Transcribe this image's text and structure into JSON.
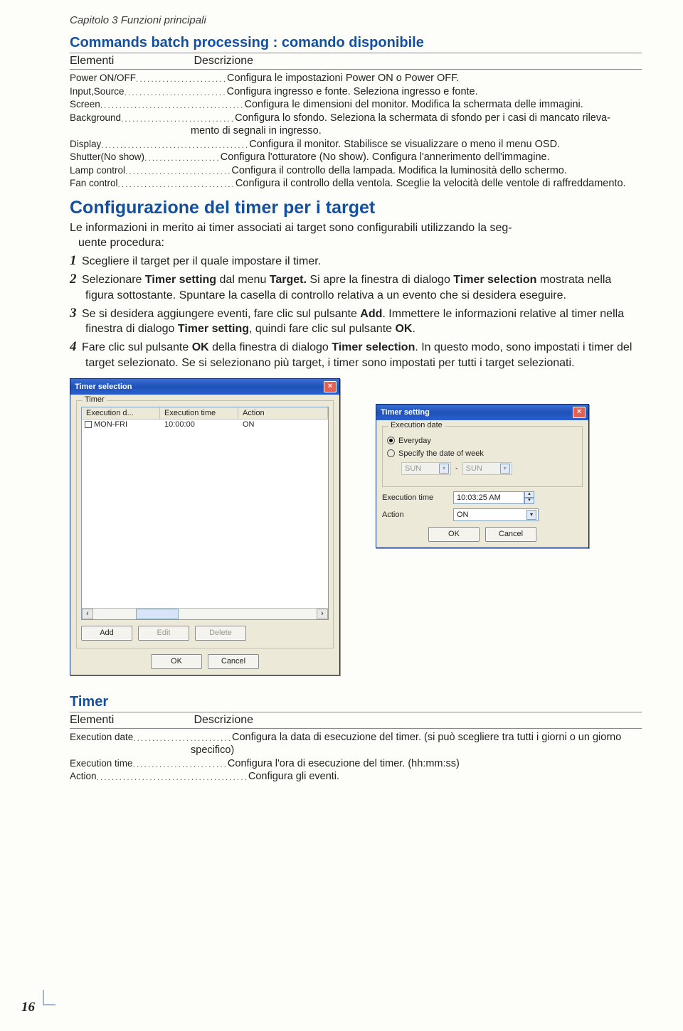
{
  "header": {
    "chapter": "Capitolo 3 Funzioni principali"
  },
  "section1": {
    "title": "Commands batch processing : comando disponibile",
    "col1": "Elementi",
    "col2": "Descrizione",
    "rows": [
      {
        "term": "Power ON/OFF",
        "dots": "........................",
        "desc": "Configura le impostazioni Power ON o Power OFF."
      },
      {
        "term": "Input,Source",
        "dots": "...........................",
        "desc": "Configura ingresso e fonte. Seleziona ingresso e fonte."
      },
      {
        "term": "Screen",
        "dots": "......................................",
        "desc": "Configura le dimensioni del monitor. Modifica la schermata delle immagini."
      },
      {
        "term": "Background",
        "dots": "..............................",
        "desc": "Configura lo sfondo. Seleziona la schermata di sfondo per i casi di mancato rileva-"
      },
      {
        "cont": "mento di segnali in ingresso."
      },
      {
        "term": "Display",
        "dots": ".......................................",
        "desc": "Configura il monitor. Stabilisce se visualizzare o meno il menu OSD."
      },
      {
        "term": "Shutter(No show)",
        "dots": "....................",
        "desc": "Configura l'otturatore (No show). Configura l'annerimento dell'immagine."
      },
      {
        "term": "Lamp control",
        "dots": "............................",
        "desc": "Configura il controllo della lampada. Modifica la luminosità dello schermo."
      },
      {
        "term": "Fan control",
        "dots": "...............................",
        "desc": "Configura il controllo della ventola. Sceglie la velocità delle ventole di raffreddamento."
      }
    ]
  },
  "section2": {
    "title": "Configurazione del timer per i target",
    "intro1": "Le informazioni in merito ai timer associati ai target sono configurabili utilizzando la seg-",
    "intro2": "uente procedura:",
    "steps": {
      "s1": {
        "n": "1",
        "t": "Scegliere il target per il quale impostare il timer."
      },
      "s2": {
        "n": "2",
        "a": "Selezionare ",
        "b1": "Timer setting",
        "c": " dal menu ",
        "b2": "Target.",
        "d": " Si apre la finestra di dialogo ",
        "b3": "Timer selection",
        "e": " mostrata nella figura sottostante. Spuntare la casella di controllo relativa a un evento che si desidera eseguire."
      },
      "s3": {
        "n": "3",
        "a": "Se si desidera aggiungere eventi, fare clic sul pulsante ",
        "b1": "Add",
        "c": ". Immettere le informazioni relative al timer nella finestra di dialogo ",
        "b2": "Timer setting",
        "d": ", quindi fare clic sul pulsante ",
        "b3": "OK",
        "e": "."
      },
      "s4": {
        "n": "4",
        "a": "Fare clic sul pulsante ",
        "b1": "OK",
        "c": " della finestra di dialogo ",
        "b2": "Timer selection",
        "d": ". In questo modo, sono impostati i timer del target selezionato. Se si selezionano più target, i timer sono impostati per tutti i target selezionati."
      }
    }
  },
  "dlg1": {
    "title": "Timer selection",
    "group": "Timer",
    "cols": {
      "c1": "Execution d...",
      "c2": "Execution time",
      "c3": "Action"
    },
    "row": {
      "c1": "MON-FRI",
      "c2": "10:00:00",
      "c3": "ON"
    },
    "btns": {
      "add": "Add",
      "edit": "Edit",
      "del": "Delete",
      "ok": "OK",
      "cancel": "Cancel"
    }
  },
  "dlg2": {
    "title": "Timer setting",
    "group": "Execution date",
    "opt1": "Everyday",
    "opt2": "Specify the date of week",
    "sun": "SUN",
    "dash": "-",
    "exectime_lbl": "Execution time",
    "exectime_val": "10:03:25 AM",
    "action_lbl": "Action",
    "action_val": "ON",
    "ok": "OK",
    "cancel": "Cancel"
  },
  "section3": {
    "title": "Timer",
    "col1": "Elementi",
    "col2": "Descrizione",
    "rows": [
      {
        "term": "Execution date",
        "dots": "..........................",
        "desc": "Configura la data di esecuzione del timer. (si può scegliere tra tutti i giorni o un giorno"
      },
      {
        "cont": "specifico)"
      },
      {
        "term": "Execution time",
        "dots": ".........................",
        "desc": "Configura l'ora di esecuzione del timer. (hh:mm:ss)"
      },
      {
        "term": "Action",
        "dots": "........................................",
        "desc": "Configura gli eventi."
      }
    ]
  },
  "pagenum": "16"
}
